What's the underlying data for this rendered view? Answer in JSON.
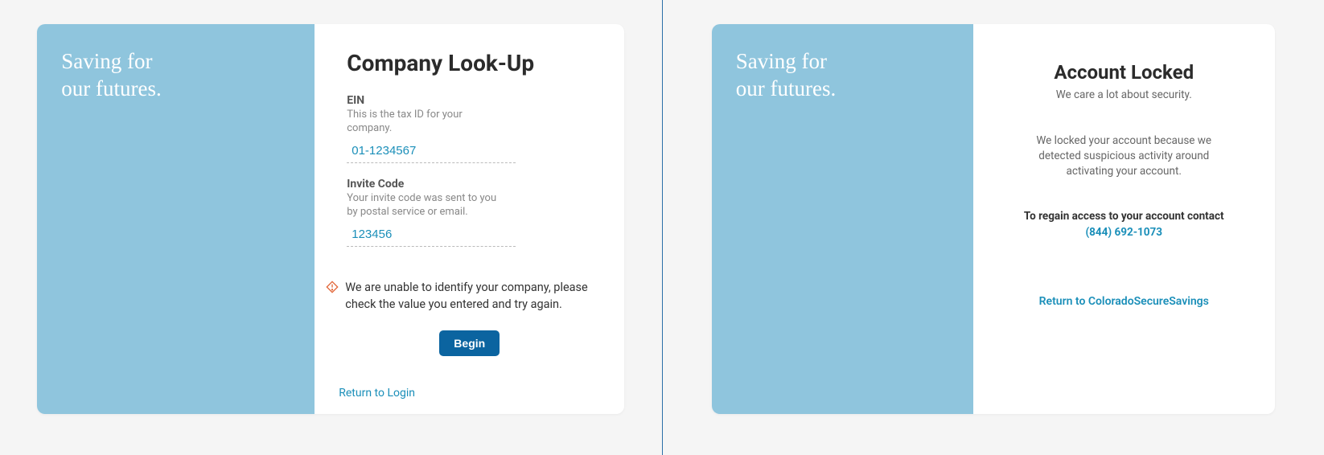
{
  "hero": {
    "line1": "Saving for",
    "line2": "our futures."
  },
  "lookup": {
    "title": "Company Look-Up",
    "ein_label": "EIN",
    "ein_helper": "This is the tax ID for your company.",
    "ein_value": "01-1234567",
    "invite_label": "Invite Code",
    "invite_helper": "Your invite code was sent to you by postal service or email.",
    "invite_value": "123456",
    "error_message": "We are unable to identify your company, please check the value you entered and try again.",
    "begin_label": "Begin",
    "return_label": "Return to Login"
  },
  "locked": {
    "title": "Account Locked",
    "subtitle": "We care a lot about security.",
    "body": "We locked your account because we detected suspicious activity around activating your account.",
    "regain_prefix": "To regain access to your account contact ",
    "phone": "(844) 692-1073",
    "return_label": "Return to ColoradoSecureSavings"
  },
  "colors": {
    "accent_blue": "#1b8fb9",
    "hero_bg": "#8fc5dd",
    "btn_bg": "#0b64a0",
    "error_icon": "#e2683a"
  }
}
